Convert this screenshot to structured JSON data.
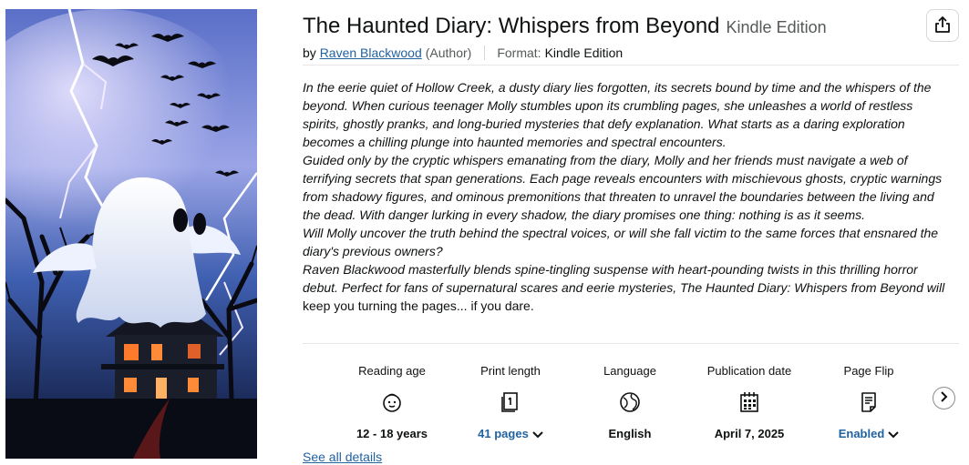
{
  "product": {
    "title": "The Haunted Diary: Whispers from Beyond",
    "edition": "Kindle Edition",
    "by_prefix": "by",
    "author": "Raven Blackwood",
    "author_role": "(Author)",
    "format_label": "Format:",
    "format_value": "Kindle Edition"
  },
  "description": [
    "In the eerie quiet of Hollow Creek, a dusty diary lies forgotten, its secrets bound by time and the whispers of the beyond. When curious teenager Molly stumbles upon its crumbling pages, she unleashes a world of restless spirits, ghostly pranks, and long-buried mysteries that defy explanation. What starts as a daring exploration becomes a chilling plunge into haunted memories and spectral encounters.",
    "Guided only by the cryptic whispers emanating from the diary, Molly and her friends must navigate a web of terrifying secrets that span generations. Each page reveals encounters with mischievous ghosts, cryptic warnings from shadowy figures, and ominous premonitions that threaten to unravel the boundaries between the living and the dead. With danger lurking in every shadow, the diary promises one thing: nothing is as it seems.",
    "Will Molly uncover the truth behind the spectral voices, or will she fall victim to the same forces that ensnared the diary's previous owners?",
    "Raven Blackwood masterfully blends spine-tingling suspense with heart-pounding twists in this thrilling horror debut. Perfect for fans of supernatural scares and eerie mysteries, The Haunted Diary: Whispers from Beyond will",
    "keep you turning the pages... if you dare."
  ],
  "attributes": [
    {
      "label": "Reading age",
      "icon": "child-face-icon",
      "value": "12 - 18 years",
      "link": false
    },
    {
      "label": "Print length",
      "icon": "book-pages-icon",
      "value": "41 pages",
      "link": true
    },
    {
      "label": "Language",
      "icon": "globe-icon",
      "value": "English",
      "link": false
    },
    {
      "label": "Publication date",
      "icon": "calendar-icon",
      "value": "April 7, 2025",
      "link": false
    },
    {
      "label": "Page Flip",
      "icon": "page-flip-icon",
      "value": "Enabled",
      "link": true
    }
  ],
  "see_all": "See all details",
  "icons": {
    "share": "share-icon",
    "next": "chevron-right-icon"
  },
  "colors": {
    "link": "#2162a1",
    "text": "#0f1111",
    "muted": "#565959",
    "divider": "#e7e7e7"
  }
}
